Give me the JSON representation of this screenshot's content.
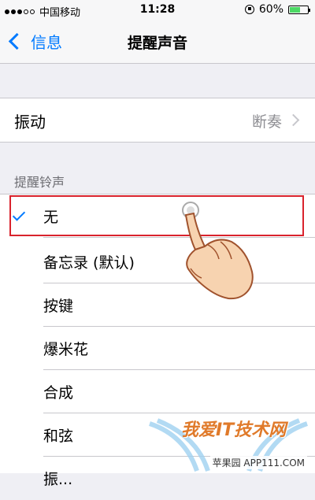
{
  "status_bar": {
    "carrier": "中国移动",
    "time": "11:28",
    "battery": "60%",
    "battery_level": 0.6
  },
  "nav": {
    "back_label": "信息",
    "title": "提醒声音"
  },
  "vibration": {
    "label": "振动",
    "value": "断奏"
  },
  "ringtone_section": {
    "header": "提醒铃声",
    "items": [
      {
        "label": "无",
        "selected": true
      },
      {
        "label": "备忘录 (默认)"
      },
      {
        "label": "按键"
      },
      {
        "label": "爆米花"
      },
      {
        "label": "合成"
      },
      {
        "label": "和弦"
      },
      {
        "label": "振..."
      }
    ]
  },
  "watermark": {
    "title": "我爱IT技术网",
    "site": "苹果园 APP111.COM"
  },
  "colors": {
    "accent": "#007aff",
    "highlight": "#d9232d",
    "battery": "#4cd964"
  }
}
